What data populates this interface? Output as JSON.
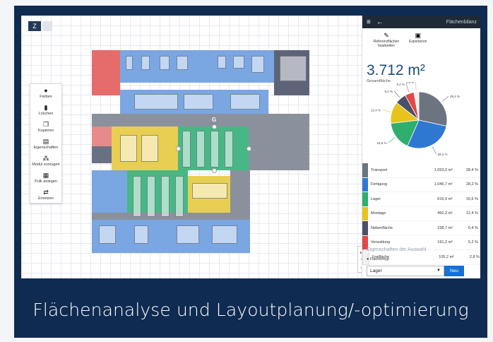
{
  "app": {
    "logo_text": "Z"
  },
  "toolbar": {
    "items": [
      {
        "icon": "palette-icon",
        "glyph": "●",
        "label": "Färben"
      },
      {
        "icon": "trash-icon",
        "glyph": "▮",
        "label": "Löschen"
      },
      {
        "icon": "copy-icon",
        "glyph": "❐",
        "label": "Kopieren"
      },
      {
        "icon": "properties-icon",
        "glyph": "▤",
        "label": "Eigenschaften"
      },
      {
        "icon": "module-icon",
        "glyph": "⁂",
        "label": "Modul erzeugen"
      },
      {
        "icon": "bulk-icon",
        "glyph": "▦",
        "label": "Pulk anlegen"
      },
      {
        "icon": "replace-icon",
        "glyph": "⇄",
        "label": "Ersetzen"
      }
    ]
  },
  "plan": {
    "marker": "G"
  },
  "zoom": {
    "plus": "+",
    "minus": "−",
    "fit": "⤢"
  },
  "panel": {
    "title": "Flächenbilanz",
    "menu_glyph": "≡",
    "back_glyph": "←",
    "actions": [
      {
        "icon": "pencil-icon",
        "glyph": "✎",
        "label": "Referenzflächen bearbeiten"
      },
      {
        "icon": "export-icon",
        "glyph": "▣",
        "label": "Exportieren"
      }
    ],
    "total": "3.712 m²",
    "total_label": "Gesamtfläche",
    "properties_heading": "Eigenschaften der Auswahl",
    "property_label": "Flächentyp",
    "select_value": "Lager",
    "new_button": "Neu"
  },
  "chart_data": {
    "type": "pie",
    "categories": [
      "Transport",
      "Fertigung",
      "Lager",
      "Montage",
      "Nebenfläche",
      "Verwaltung",
      "Freifläche"
    ],
    "values": [
      28.4,
      28.2,
      16.6,
      12.4,
      6.4,
      5.2,
      2.8
    ],
    "slice_labels": [
      "28,4 %",
      "28,2 %",
      "16,6 %",
      "12,4 %",
      "6,4 %",
      "5,2 %",
      "2,8 %"
    ],
    "colors": [
      "#6c7480",
      "#2f78d2",
      "#2fae6e",
      "#e7c31e",
      "#4b5068",
      "#e34747",
      "#f0f0f0"
    ]
  },
  "table": {
    "rows": [
      {
        "name": "Transport",
        "area": "1.053,0 m²",
        "pct": "28,4 %",
        "color": "#6c7480"
      },
      {
        "name": "Fertigung",
        "area": "1.046,7 m²",
        "pct": "28,2 %",
        "color": "#2f78d2"
      },
      {
        "name": "Lager",
        "area": "616,9 m²",
        "pct": "16,6 %",
        "color": "#2fae6e"
      },
      {
        "name": "Montage",
        "area": "460,2 m²",
        "pct": "12,4 %",
        "color": "#e7c31e"
      },
      {
        "name": "Nebenfläche",
        "area": "238,7 m²",
        "pct": "6,4 %",
        "color": "#4b5068"
      },
      {
        "name": "Verwaltung",
        "area": "191,2 m²",
        "pct": "5,2 %",
        "color": "#e34747"
      },
      {
        "name": "Freifläche",
        "area": "105,2 m²",
        "pct": "2,8 %",
        "color": "#f0f0f0"
      }
    ]
  },
  "caption": "Flächenanalyse und Layoutplanung/-optimierung"
}
